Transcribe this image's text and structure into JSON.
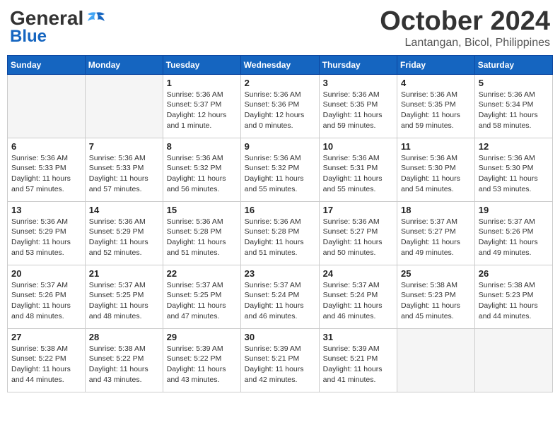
{
  "header": {
    "logo_general": "General",
    "logo_blue": "Blue",
    "month": "October 2024",
    "location": "Lantangan, Bicol, Philippines"
  },
  "weekdays": [
    "Sunday",
    "Monday",
    "Tuesday",
    "Wednesday",
    "Thursday",
    "Friday",
    "Saturday"
  ],
  "weeks": [
    [
      {
        "day": "",
        "info": ""
      },
      {
        "day": "",
        "info": ""
      },
      {
        "day": "1",
        "info": "Sunrise: 5:36 AM\nSunset: 5:37 PM\nDaylight: 12 hours\nand 1 minute."
      },
      {
        "day": "2",
        "info": "Sunrise: 5:36 AM\nSunset: 5:36 PM\nDaylight: 12 hours\nand 0 minutes."
      },
      {
        "day": "3",
        "info": "Sunrise: 5:36 AM\nSunset: 5:35 PM\nDaylight: 11 hours\nand 59 minutes."
      },
      {
        "day": "4",
        "info": "Sunrise: 5:36 AM\nSunset: 5:35 PM\nDaylight: 11 hours\nand 59 minutes."
      },
      {
        "day": "5",
        "info": "Sunrise: 5:36 AM\nSunset: 5:34 PM\nDaylight: 11 hours\nand 58 minutes."
      }
    ],
    [
      {
        "day": "6",
        "info": "Sunrise: 5:36 AM\nSunset: 5:33 PM\nDaylight: 11 hours\nand 57 minutes."
      },
      {
        "day": "7",
        "info": "Sunrise: 5:36 AM\nSunset: 5:33 PM\nDaylight: 11 hours\nand 57 minutes."
      },
      {
        "day": "8",
        "info": "Sunrise: 5:36 AM\nSunset: 5:32 PM\nDaylight: 11 hours\nand 56 minutes."
      },
      {
        "day": "9",
        "info": "Sunrise: 5:36 AM\nSunset: 5:32 PM\nDaylight: 11 hours\nand 55 minutes."
      },
      {
        "day": "10",
        "info": "Sunrise: 5:36 AM\nSunset: 5:31 PM\nDaylight: 11 hours\nand 55 minutes."
      },
      {
        "day": "11",
        "info": "Sunrise: 5:36 AM\nSunset: 5:30 PM\nDaylight: 11 hours\nand 54 minutes."
      },
      {
        "day": "12",
        "info": "Sunrise: 5:36 AM\nSunset: 5:30 PM\nDaylight: 11 hours\nand 53 minutes."
      }
    ],
    [
      {
        "day": "13",
        "info": "Sunrise: 5:36 AM\nSunset: 5:29 PM\nDaylight: 11 hours\nand 53 minutes."
      },
      {
        "day": "14",
        "info": "Sunrise: 5:36 AM\nSunset: 5:29 PM\nDaylight: 11 hours\nand 52 minutes."
      },
      {
        "day": "15",
        "info": "Sunrise: 5:36 AM\nSunset: 5:28 PM\nDaylight: 11 hours\nand 51 minutes."
      },
      {
        "day": "16",
        "info": "Sunrise: 5:36 AM\nSunset: 5:28 PM\nDaylight: 11 hours\nand 51 minutes."
      },
      {
        "day": "17",
        "info": "Sunrise: 5:36 AM\nSunset: 5:27 PM\nDaylight: 11 hours\nand 50 minutes."
      },
      {
        "day": "18",
        "info": "Sunrise: 5:37 AM\nSunset: 5:27 PM\nDaylight: 11 hours\nand 49 minutes."
      },
      {
        "day": "19",
        "info": "Sunrise: 5:37 AM\nSunset: 5:26 PM\nDaylight: 11 hours\nand 49 minutes."
      }
    ],
    [
      {
        "day": "20",
        "info": "Sunrise: 5:37 AM\nSunset: 5:26 PM\nDaylight: 11 hours\nand 48 minutes."
      },
      {
        "day": "21",
        "info": "Sunrise: 5:37 AM\nSunset: 5:25 PM\nDaylight: 11 hours\nand 48 minutes."
      },
      {
        "day": "22",
        "info": "Sunrise: 5:37 AM\nSunset: 5:25 PM\nDaylight: 11 hours\nand 47 minutes."
      },
      {
        "day": "23",
        "info": "Sunrise: 5:37 AM\nSunset: 5:24 PM\nDaylight: 11 hours\nand 46 minutes."
      },
      {
        "day": "24",
        "info": "Sunrise: 5:37 AM\nSunset: 5:24 PM\nDaylight: 11 hours\nand 46 minutes."
      },
      {
        "day": "25",
        "info": "Sunrise: 5:38 AM\nSunset: 5:23 PM\nDaylight: 11 hours\nand 45 minutes."
      },
      {
        "day": "26",
        "info": "Sunrise: 5:38 AM\nSunset: 5:23 PM\nDaylight: 11 hours\nand 44 minutes."
      }
    ],
    [
      {
        "day": "27",
        "info": "Sunrise: 5:38 AM\nSunset: 5:22 PM\nDaylight: 11 hours\nand 44 minutes."
      },
      {
        "day": "28",
        "info": "Sunrise: 5:38 AM\nSunset: 5:22 PM\nDaylight: 11 hours\nand 43 minutes."
      },
      {
        "day": "29",
        "info": "Sunrise: 5:39 AM\nSunset: 5:22 PM\nDaylight: 11 hours\nand 43 minutes."
      },
      {
        "day": "30",
        "info": "Sunrise: 5:39 AM\nSunset: 5:21 PM\nDaylight: 11 hours\nand 42 minutes."
      },
      {
        "day": "31",
        "info": "Sunrise: 5:39 AM\nSunset: 5:21 PM\nDaylight: 11 hours\nand 41 minutes."
      },
      {
        "day": "",
        "info": ""
      },
      {
        "day": "",
        "info": ""
      }
    ]
  ]
}
